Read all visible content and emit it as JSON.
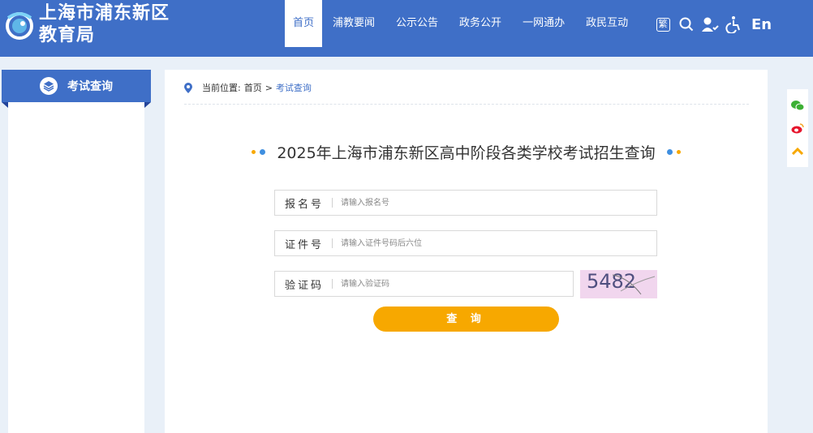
{
  "header": {
    "logo_line1": "上海市浦东新区",
    "logo_line2": "教育局",
    "nav": [
      {
        "label": "首页",
        "active": true
      },
      {
        "label": "浦教要闻",
        "active": false
      },
      {
        "label": "公示公告",
        "active": false
      },
      {
        "label": "政务公开",
        "active": false
      },
      {
        "label": "一网通办",
        "active": false
      },
      {
        "label": "政民互动",
        "active": false
      }
    ],
    "tools": {
      "traditional": "繁",
      "english": "En"
    }
  },
  "sidebar": {
    "tab_label": "考试查询"
  },
  "breadcrumb": {
    "prefix": "当前位置:",
    "home": "首页",
    "sep": ">",
    "current": "考试查询"
  },
  "form": {
    "title": "2025年上海市浦东新区高中阶段各类学校考试招生查询",
    "fields": [
      {
        "label": "报名号",
        "placeholder": "请输入报名号"
      },
      {
        "label": "证件号",
        "placeholder": "请输入证件号码后六位"
      },
      {
        "label": "验证码",
        "placeholder": "请输入验证码"
      }
    ],
    "captcha": "5482",
    "submit": "查 询"
  },
  "colors": {
    "primary": "#3f6fc7",
    "accent": "#f7a800",
    "background": "#e9f0f8"
  }
}
